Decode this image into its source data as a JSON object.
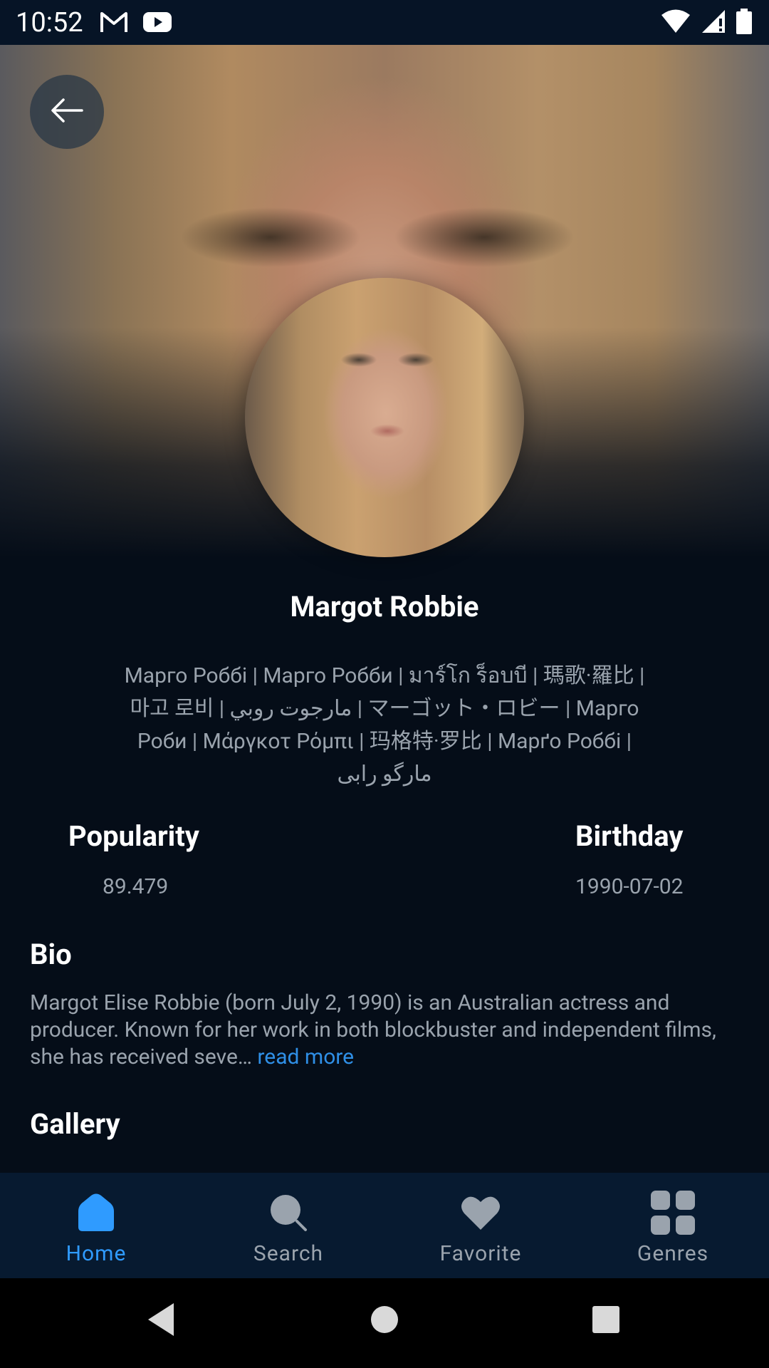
{
  "status_bar": {
    "time": "10:52",
    "left_icons": [
      "gmail-icon",
      "youtube-icon"
    ],
    "right_icons": [
      "wifi-icon",
      "signal-icon",
      "battery-icon"
    ]
  },
  "header": {
    "back_icon": "arrow-left-icon"
  },
  "person": {
    "name": "Margot Robbie",
    "also_known_as": "Марго Роббі | Марго Робби | มาร์โก ร็อบบี | 瑪歌·羅比 | 마고 로비 | مارجوت روبي | マーゴット・ロビー | Марго Роби | Μάργκοτ Ρόμπι | 玛格特·罗比 | Марґо Роббі | مارگو رابی"
  },
  "stats": {
    "popularity_label": "Popularity",
    "popularity_value": "89.479",
    "birthday_label": "Birthday",
    "birthday_value": "1990-07-02"
  },
  "bio": {
    "title": "Bio",
    "text": "Margot Elise Robbie (born July 2, 1990) is an Australian actress and producer. Known for her work in both blockbuster and independent films, she has received seve…",
    "read_more": "read more"
  },
  "gallery": {
    "title": "Gallery"
  },
  "bottom_nav": {
    "items": [
      {
        "label": "Home",
        "icon": "home-icon",
        "active": true
      },
      {
        "label": "Search",
        "icon": "search-icon",
        "active": false
      },
      {
        "label": "Favorite",
        "icon": "heart-icon",
        "active": false
      },
      {
        "label": "Genres",
        "icon": "grid-icon",
        "active": false
      }
    ]
  },
  "colors": {
    "background": "#050d18",
    "nav_background": "#071a30",
    "accent": "#2f9bff",
    "muted_text": "#9aa3ad"
  }
}
